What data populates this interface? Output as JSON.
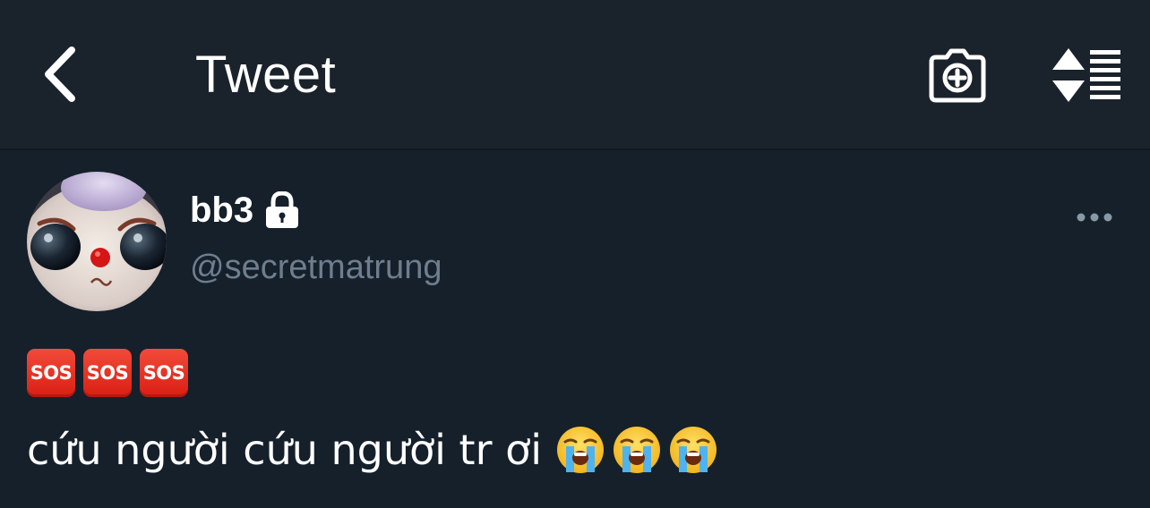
{
  "header": {
    "title": "Tweet",
    "back_icon": "chevron-left-icon",
    "camera_icon": "camera-plus-icon",
    "sort_icon": "sort-lines-icon"
  },
  "tweet": {
    "display_name": "bb3",
    "protected_icon": "lock-icon",
    "handle": "@secretmatrung",
    "more_icon": "more-horizontal-icon",
    "sos_badges": [
      "SOS",
      "SOS",
      "SOS"
    ],
    "text": "cứu người cứu người tr ơi",
    "trailing_emojis": [
      "loudly-crying-face",
      "loudly-crying-face",
      "loudly-crying-face"
    ]
  },
  "colors": {
    "background": "#15202b",
    "header_background": "#1a222c",
    "text_primary": "#ffffff",
    "text_secondary": "#6e7e8e",
    "sos_red": "#e1281a"
  }
}
